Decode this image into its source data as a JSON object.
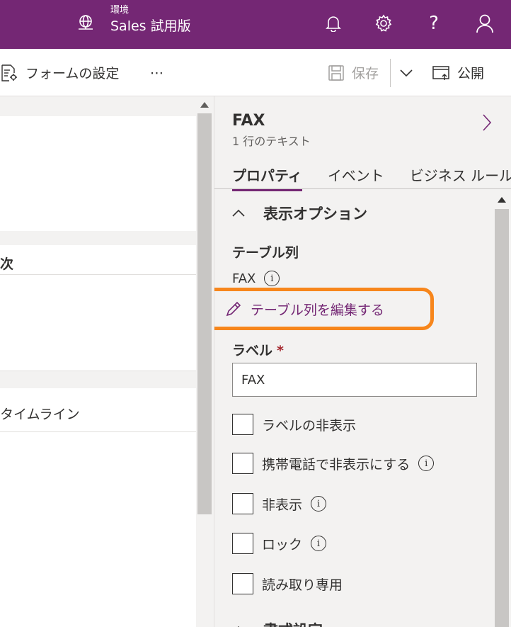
{
  "header": {
    "env_label": "環境",
    "env_name": "Sales 試用版",
    "bg_color": "#742774"
  },
  "command_bar": {
    "form_settings": "フォームの設定",
    "more": "⋯",
    "save": "保存",
    "publish": "公開"
  },
  "canvas": {
    "section_label": "次",
    "timeline_label": "タイムライン"
  },
  "panel": {
    "field_name": "FAX",
    "field_type": "1 行のテキスト",
    "tabs": [
      {
        "label": "プロパティ",
        "active": true
      },
      {
        "label": "イベント",
        "active": false
      },
      {
        "label": "ビジネス ルール",
        "active": false
      }
    ],
    "section_title": "表示オプション",
    "table_column_label": "テーブル列",
    "table_column_value": "FAX",
    "edit_link": "テーブル列を編集する",
    "label_label": "ラベル",
    "required_mark": "*",
    "label_value": "FAX",
    "checkboxes": [
      {
        "label": "ラベルの非表示",
        "info": false
      },
      {
        "label": "携帯電話で非表示にする",
        "info": true
      },
      {
        "label": "非表示",
        "info": true
      },
      {
        "label": "ロック",
        "info": true
      },
      {
        "label": "読み取り専用",
        "info": false
      }
    ],
    "next_section": "書式設定",
    "highlight_color": "#f7861c"
  }
}
